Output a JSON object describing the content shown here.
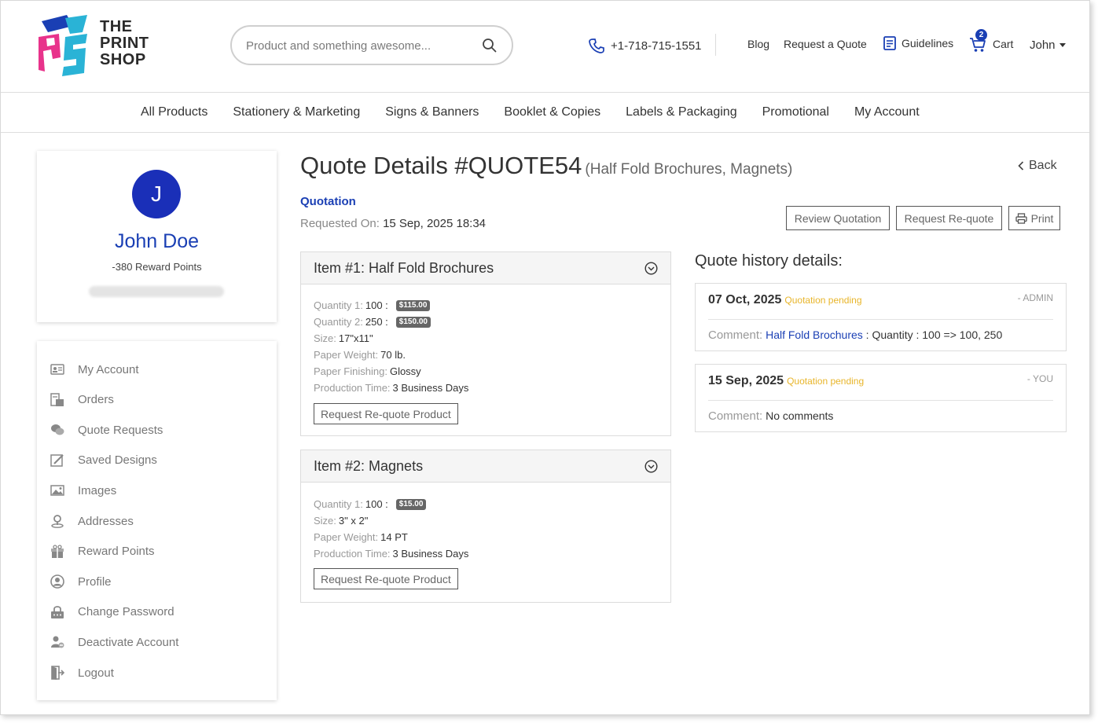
{
  "brand": {
    "line1": "THE",
    "line2": "PRINT",
    "line3": "SHOP",
    "colors": {
      "blue": "#1a3fb4",
      "magenta": "#e8338b",
      "cyan": "#2ab3d6"
    }
  },
  "search": {
    "placeholder": "Product and something awesome..."
  },
  "header": {
    "phone": "+1-718-715-1551",
    "blog": "Blog",
    "request_quote": "Request a Quote",
    "guidelines": "Guidelines",
    "cart_label": "Cart",
    "cart_count": "2",
    "user": "John"
  },
  "nav": [
    "All Products",
    "Stationery & Marketing",
    "Signs & Banners",
    "Booklet & Copies",
    "Labels & Packaging",
    "Promotional",
    "My Account"
  ],
  "profile": {
    "initial": "J",
    "name": "John Doe",
    "reward_points": "-380 Reward Points"
  },
  "side_menu": [
    {
      "label": "My Account",
      "icon": "id-card-icon"
    },
    {
      "label": "Orders",
      "icon": "orders-icon"
    },
    {
      "label": "Quote Requests",
      "icon": "chat-bubbles-icon"
    },
    {
      "label": "Saved Designs",
      "icon": "design-edit-icon"
    },
    {
      "label": "Images",
      "icon": "images-icon"
    },
    {
      "label": "Addresses",
      "icon": "map-pin-icon"
    },
    {
      "label": "Reward Points",
      "icon": "gift-box-icon"
    },
    {
      "label": "Profile",
      "icon": "user-circle-icon"
    },
    {
      "label": "Change Password",
      "icon": "lock-password-icon"
    },
    {
      "label": "Deactivate Account",
      "icon": "user-remove-icon"
    },
    {
      "label": "Logout",
      "icon": "logout-icon"
    }
  ],
  "quote": {
    "title": "Quote Details #QUOTE54",
    "subtitle": "(Half Fold Brochures, Magnets)",
    "back": "Back",
    "status_label": "Quotation",
    "requested_label": "Requested On:",
    "requested_value": "15 Sep, 2025 18:34",
    "buttons": {
      "review": "Review Quotation",
      "requote": "Request Re-quote",
      "print": "Print"
    }
  },
  "items": [
    {
      "title": "Item #1: Half Fold Brochures",
      "specs": [
        {
          "label": "Quantity 1:",
          "value": "100 :",
          "price": "$115.00"
        },
        {
          "label": "Quantity 2:",
          "value": "250 :",
          "price": "$150.00"
        },
        {
          "label": "Size:",
          "value": "17\"x11\""
        },
        {
          "label": "Paper Weight:",
          "value": "70 lb."
        },
        {
          "label": "Paper Finishing:",
          "value": "Glossy"
        },
        {
          "label": "Production Time:",
          "value": "3 Business Days"
        }
      ],
      "button": "Request Re-quote Product"
    },
    {
      "title": "Item #2: Magnets",
      "specs": [
        {
          "label": "Quantity 1:",
          "value": "100 :",
          "price": "$15.00"
        },
        {
          "label": "Size:",
          "value": "3\" x 2\""
        },
        {
          "label": "Paper Weight:",
          "value": "14 PT"
        },
        {
          "label": "Production Time:",
          "value": "3 Business Days"
        }
      ],
      "button": "Request Re-quote Product"
    }
  ],
  "history": {
    "title": "Quote history details:",
    "entries": [
      {
        "date": "07 Oct, 2025",
        "status": "Quotation pending",
        "who": "- ADMIN",
        "comment_label": "Comment:",
        "comment_link": "Half Fold Brochures",
        "comment_text": " : Quantity : 100 => 100, 250"
      },
      {
        "date": "15 Sep, 2025",
        "status": "Quotation pending",
        "who": "- YOU",
        "comment_label": "Comment:",
        "comment_link": "",
        "comment_text": "No comments"
      }
    ]
  }
}
